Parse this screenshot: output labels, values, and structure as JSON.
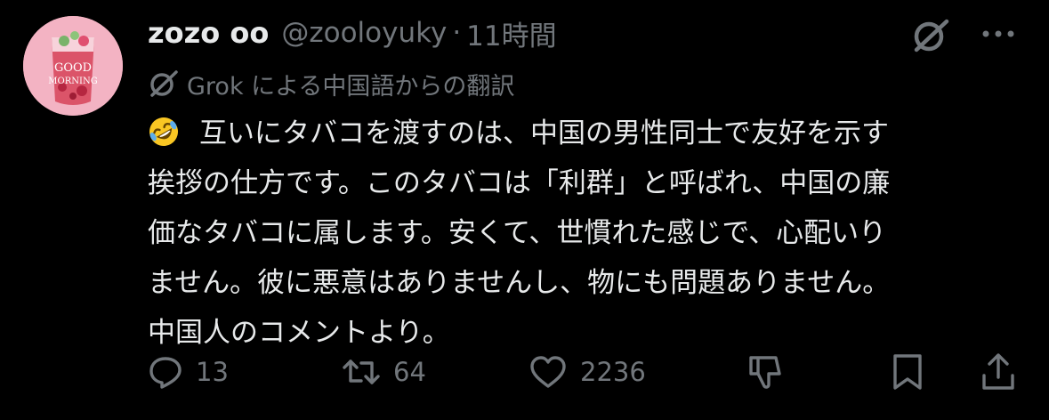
{
  "post": {
    "author": {
      "display_name": "zozo oo",
      "handle": "@zooloyuky",
      "avatar_text_line1": "GOOD",
      "avatar_text_line2": "MORNING"
    },
    "separator": "·",
    "timestamp": "11時間",
    "translation_label": "Grok による中国語からの翻訳",
    "emoji": "rolling-on-the-floor-laughing",
    "body_lines": [
      "互いにタバコを渡すのは、中国の男性同士で友好を示す",
      "挨拶の仕方です。このタバコは「利群」と呼ばれ、中国の廉",
      "価なタバコに属します。安くて、世慣れた感じで、心配いり",
      "ません。彼に悪意はありませんし、物にも問題ありません。",
      "中国人のコメントより。"
    ],
    "metrics": {
      "replies": "13",
      "reposts": "64",
      "likes": "2236"
    },
    "icons": {
      "grok": "grok-icon",
      "more": "more-icon",
      "reply": "reply-icon",
      "repost": "repost-icon",
      "like": "heart-icon",
      "dislike": "thumbs-down-icon",
      "bookmark": "bookmark-icon",
      "share": "share-icon"
    }
  },
  "colors": {
    "background": "#000000",
    "primary_text": "#e7e9ea",
    "secondary_text": "#71767b",
    "avatar_bg": "#f2a6b8"
  }
}
